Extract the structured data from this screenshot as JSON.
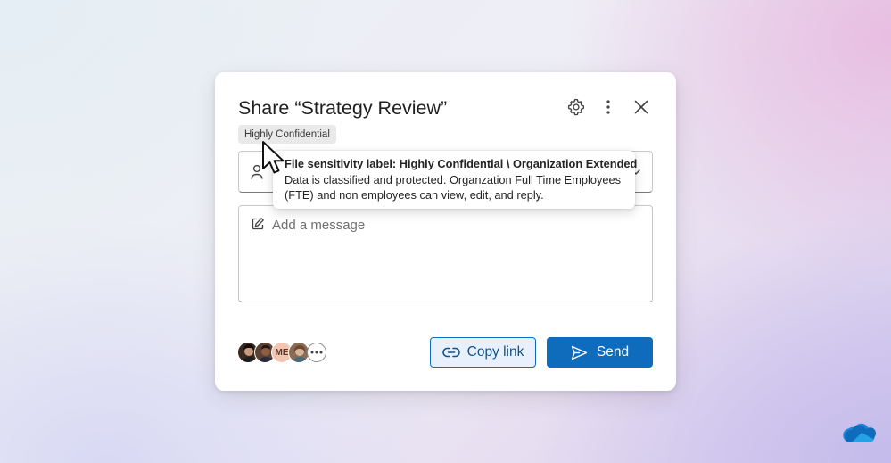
{
  "dialog": {
    "title": "Share “Strategy Review”",
    "sensitivity_badge": "Highly Confidential",
    "header_icons": [
      "gear-icon",
      "more-vertical-icon",
      "close-icon"
    ]
  },
  "to_field": {
    "icon": "person-icon",
    "dropdown_icon": "chevron-down-icon"
  },
  "message": {
    "icon": "edit-icon",
    "placeholder": "Add a message"
  },
  "avatars": {
    "items": [
      {
        "type": "photo",
        "color": "#3a2a22"
      },
      {
        "type": "photo",
        "color": "#5b4034"
      },
      {
        "type": "initials",
        "initials": "ME",
        "color": "#f3c5b0"
      },
      {
        "type": "photo",
        "color": "#8a6b55"
      }
    ],
    "more_icon": "more-horizontal-icon"
  },
  "actions": {
    "copy_link_label": "Copy link",
    "send_label": "Send"
  },
  "tooltip": {
    "title": "File sensitivity label: Highly Confidential \\ Organization Extended",
    "body": "Data is classified and protected. Organzation Full Time Employees (FTE) and non employees can view, edit, and reply."
  },
  "colors": {
    "accent": "#0f6cbd",
    "accent_light": "#e8f1fb",
    "badge_bg": "#e9e9e9"
  },
  "brand_icon": "onedrive-cloud-icon"
}
